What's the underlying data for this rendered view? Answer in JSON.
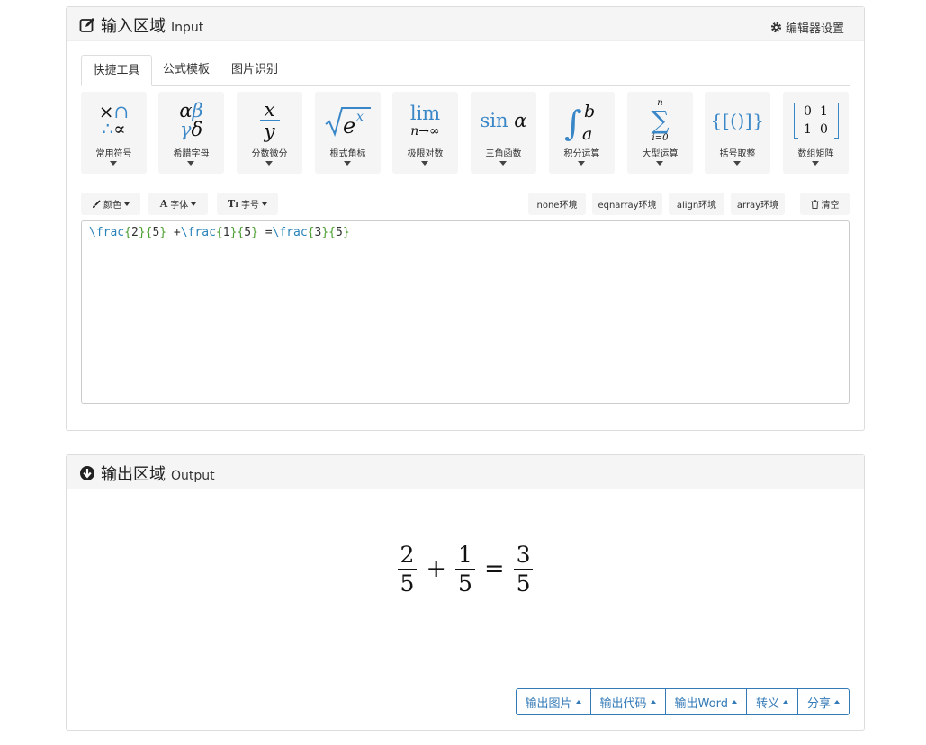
{
  "input_panel": {
    "title_cn": "输入区域",
    "title_en": "Input",
    "settings_label": "编辑器设置"
  },
  "tabs": [
    {
      "label": "快捷工具",
      "active": true
    },
    {
      "label": "公式模板",
      "active": false
    },
    {
      "label": "图片识别",
      "active": false
    }
  ],
  "tools": [
    {
      "label": "常用符号",
      "icon": "common-symbols-icon"
    },
    {
      "label": "希腊字母",
      "icon": "greek-letters-icon"
    },
    {
      "label": "分数微分",
      "icon": "fraction-icon"
    },
    {
      "label": "根式角标",
      "icon": "radical-icon"
    },
    {
      "label": "极限对数",
      "icon": "limit-icon"
    },
    {
      "label": "三角函数",
      "icon": "trig-icon"
    },
    {
      "label": "积分运算",
      "icon": "integral-icon"
    },
    {
      "label": "大型运算",
      "icon": "summation-icon"
    },
    {
      "label": "括号取整",
      "icon": "brackets-icon"
    },
    {
      "label": "数组矩阵",
      "icon": "matrix-icon"
    }
  ],
  "tool_glyphs": {
    "lim_text": "lim",
    "lim_sub": "n→∞",
    "sin_text": "sin",
    "brackets_text": "{[()]}",
    "matrix_cells": [
      "0",
      "1",
      "1",
      "0"
    ]
  },
  "format_bar": {
    "color_label": "颜色",
    "font_label": "字体",
    "size_label": "字号"
  },
  "env_buttons": [
    "none环境",
    "eqnarray环境",
    "align环境",
    "array环境"
  ],
  "clear_label": "清空",
  "editor": {
    "code": "\\frac{2}{5} +\\frac{1}{5} =\\frac{3}{5}"
  },
  "output_panel": {
    "title_cn": "输出区域",
    "title_en": "Output"
  },
  "rendered_formula": {
    "fractions": [
      {
        "num": "2",
        "den": "5"
      },
      {
        "num": "1",
        "den": "5"
      },
      {
        "num": "3",
        "den": "5"
      }
    ],
    "operators": [
      "+",
      "="
    ]
  },
  "output_buttons": [
    "输出图片",
    "输出代码",
    "输出Word",
    "转义",
    "分享"
  ],
  "colors": {
    "accent": "#337ab7",
    "latex_command": "#2a83b9",
    "latex_brace": "#4a9e2f",
    "icon_blue": "#3a87c8"
  }
}
